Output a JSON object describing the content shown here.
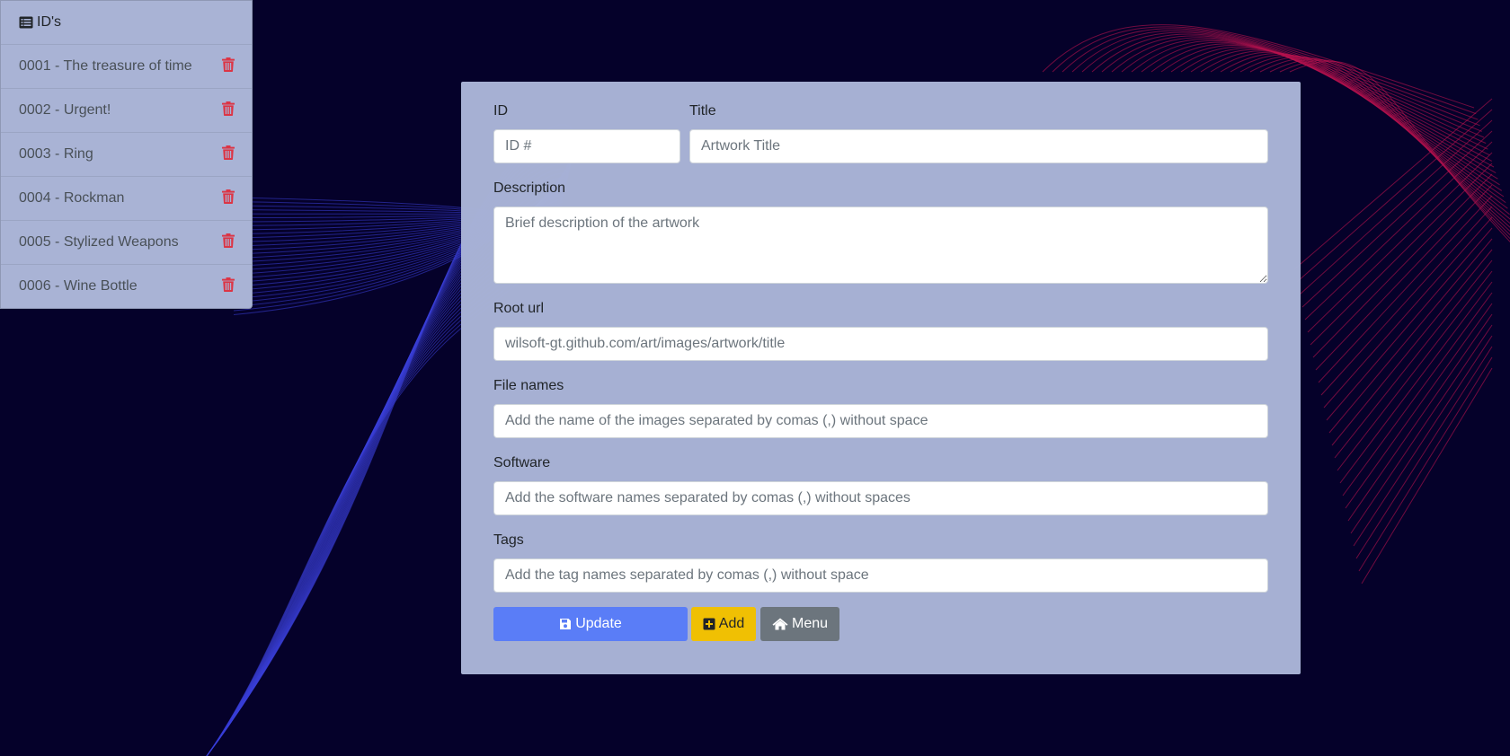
{
  "sidebar": {
    "header": {
      "icon": "list-icon",
      "label": "ID's"
    },
    "items": [
      {
        "label": "0001 - The treasure of time",
        "delete_icon": "trash-icon"
      },
      {
        "label": "0002 - Urgent!",
        "delete_icon": "trash-icon"
      },
      {
        "label": "0003 - Ring",
        "delete_icon": "trash-icon"
      },
      {
        "label": "0004 - Rockman",
        "delete_icon": "trash-icon"
      },
      {
        "label": "0005 - Stylized Weapons",
        "delete_icon": "trash-icon"
      },
      {
        "label": "0006 - Wine Bottle",
        "delete_icon": "trash-icon"
      }
    ]
  },
  "form": {
    "id": {
      "label": "ID",
      "value": "",
      "placeholder": "ID #"
    },
    "title": {
      "label": "Title",
      "value": "",
      "placeholder": "Artwork Title"
    },
    "description": {
      "label": "Description",
      "value": "",
      "placeholder": "Brief description of the artwork"
    },
    "root_url": {
      "label": "Root url",
      "value": "",
      "placeholder": "wilsoft-gt.github.com/art/images/artwork/title"
    },
    "file_names": {
      "label": "File names",
      "value": "",
      "placeholder": "Add the name of the images separated by comas (,) without space"
    },
    "software": {
      "label": "Software",
      "value": "",
      "placeholder": "Add the software names separated by comas (,) without spaces"
    },
    "tags": {
      "label": "Tags",
      "value": "",
      "placeholder": "Add the tag names separated by comas (,) without space"
    }
  },
  "buttons": {
    "update": {
      "label": "Update",
      "icon": "save-icon"
    },
    "add": {
      "label": "Add",
      "icon": "plus-square-icon"
    },
    "menu": {
      "label": "Menu",
      "icon": "home-icon"
    }
  },
  "colors": {
    "background": "#05012a",
    "panel": "#a9b3d5",
    "update_button": "#5a7df7",
    "add_button": "#f0c003",
    "menu_button": "#6c757d",
    "delete_icon": "#dc3545",
    "wave_blue": "#3a40d8",
    "wave_red": "#b8124e"
  }
}
